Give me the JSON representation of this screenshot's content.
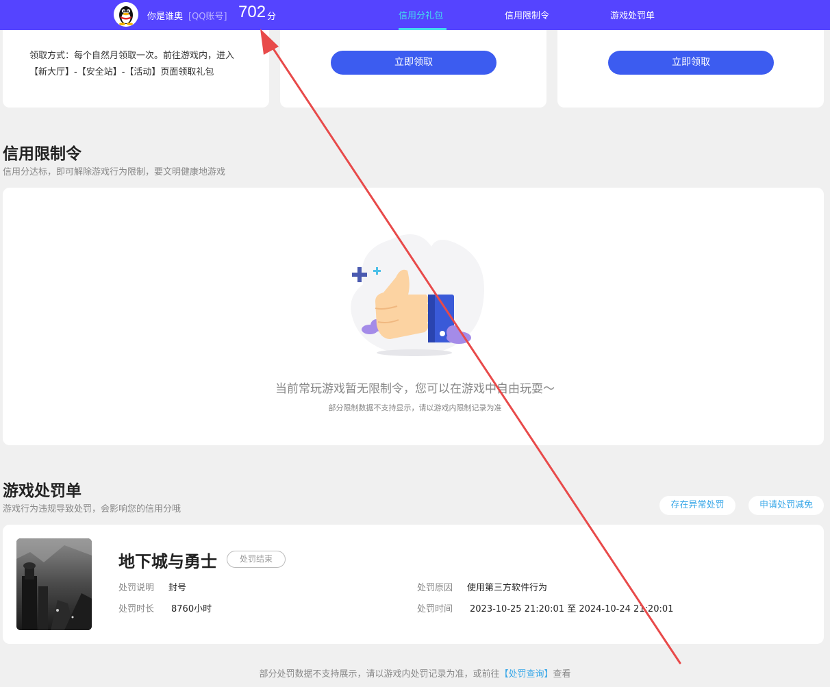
{
  "header": {
    "username": "你是谁奥",
    "account_type": "[QQ账号]",
    "score": "702",
    "score_unit": "分",
    "tabs": [
      {
        "label": "信用分礼包",
        "active": true
      },
      {
        "label": "信用限制令",
        "active": false
      },
      {
        "label": "游戏处罚单",
        "active": false
      }
    ]
  },
  "gift_cards": {
    "card1_text": "领取方式：每个自然月领取一次。前往游戏内，进入【新大厅】-【安全站】-【活动】页面领取礼包",
    "card2_button": "立即领取",
    "card3_button": "立即领取"
  },
  "restriction": {
    "title": "信用限制令",
    "subtitle": "信用分达标，即可解除游戏行为限制，要文明健康地游戏",
    "empty_title": "当前常玩游戏暂无限制令，您可以在游戏中自由玩耍～",
    "empty_sub": "部分限制数据不支持显示，请以游戏内限制记录为准"
  },
  "penalty": {
    "title": "游戏处罚单",
    "subtitle": "游戏行为违规导致处罚，会影响您的信用分哦",
    "btn_abnormal": "存在异常处罚",
    "btn_reduce": "申请处罚减免",
    "game_name": "地下城与勇士",
    "status": "处罚结束",
    "desc_label": "处罚说明",
    "desc_value": "封号",
    "duration_label": "处罚时长",
    "duration_value": "8760小时",
    "reason_label": "处罚原因",
    "reason_value": "使用第三方软件行为",
    "time_label": "处罚时间",
    "time_value": "2023-10-25 21:20:01 至 2024-10-24 21:20:01"
  },
  "footer": {
    "note_prefix": "部分处罚数据不支持展示，请以游戏内处罚记录为准，或前往",
    "link": "【处罚查询】",
    "note_suffix": "查看"
  },
  "colors": {
    "topbar": "#5544ff",
    "active_tab": "#44ddee",
    "button": "#3c5cf0",
    "link": "#3aa8e8",
    "annotation": "#e84a4a"
  },
  "icons": [
    "qq-penguin-icon",
    "thumbs-up-illustration",
    "game-cover-image"
  ]
}
